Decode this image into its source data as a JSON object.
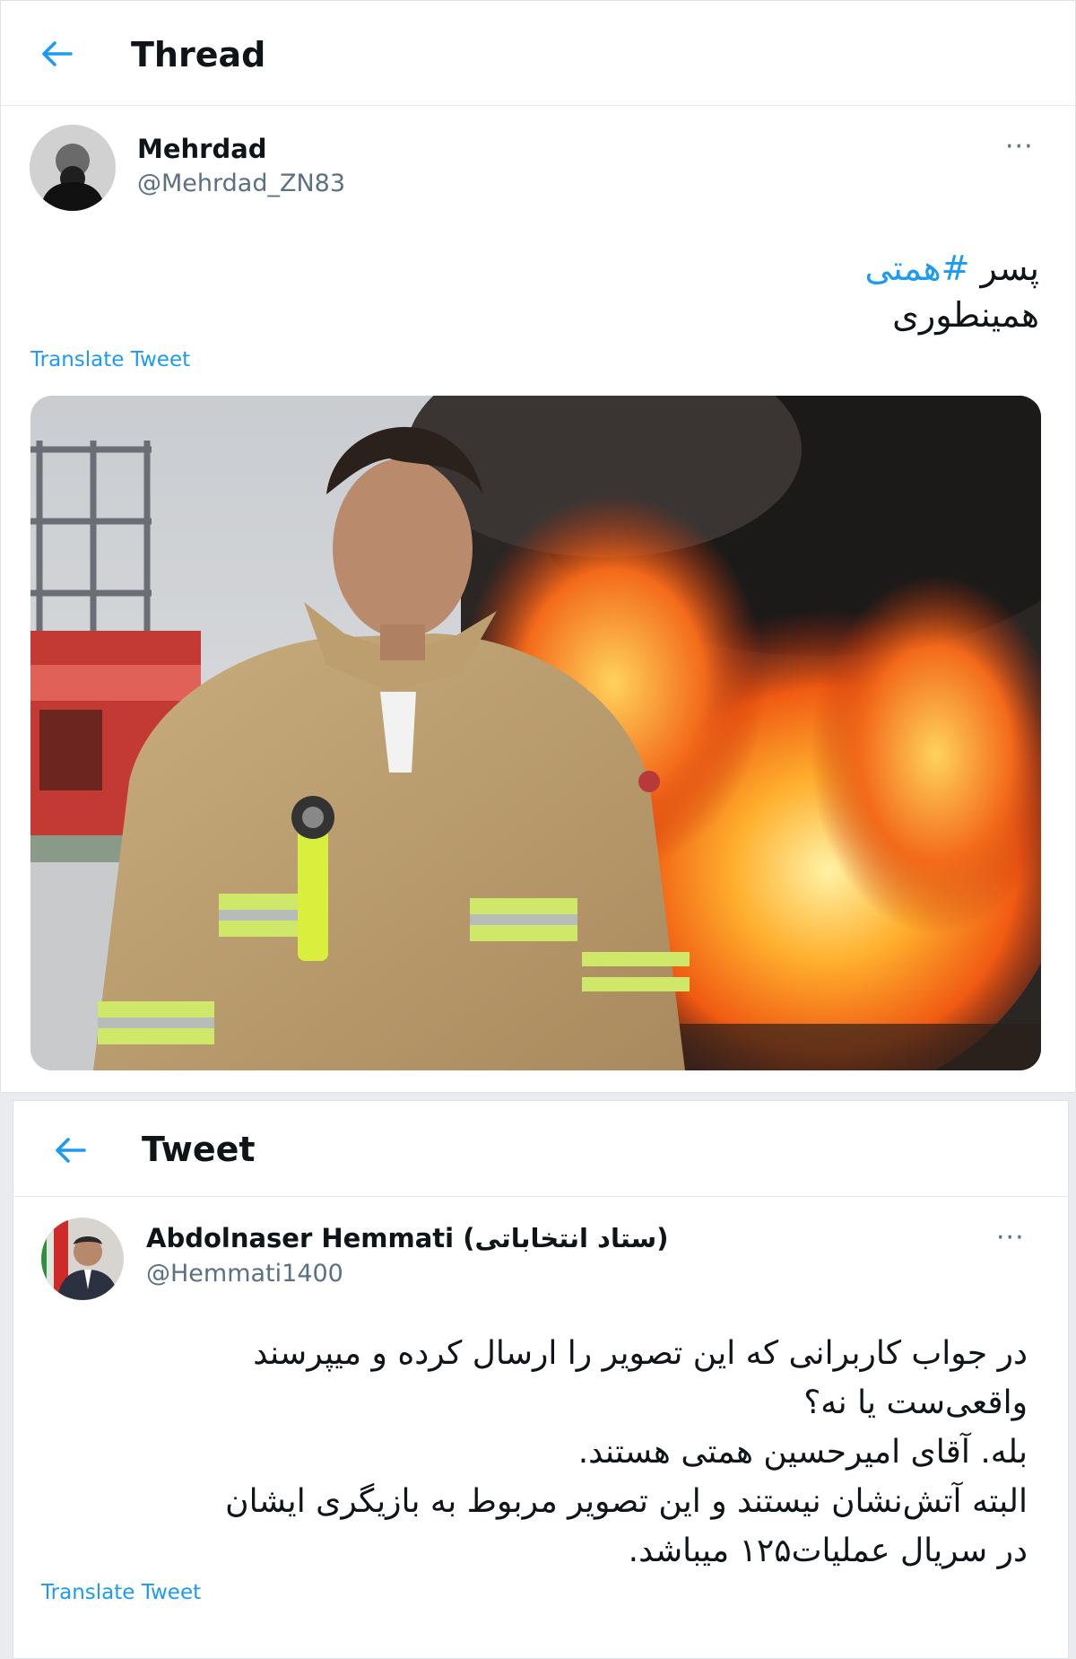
{
  "thread": {
    "header_title": "Thread",
    "author": {
      "display_name": "Mehrdad",
      "handle": "@Mehrdad_ZN83"
    },
    "text": {
      "prefix": "پسر ",
      "hashtag": "#همتی",
      "line2": "همینطوری"
    },
    "translate_label": "Translate Tweet",
    "more_label": "···"
  },
  "reply": {
    "header_title": "Tweet",
    "author": {
      "display_name": "Abdolnaser Hemmati",
      "affiliation": "(ستاد انتخاباتی)",
      "handle": "@Hemmati1400"
    },
    "text_lines": [
      "در جواب کاربرانی که این تصویر را ارسال کرده و میپرسند",
      "واقعی‌ست یا نه؟",
      "بله. آقای امیرحسین همتی هستند.",
      "البته آتش‌نشان نیستند و این تصویر مربوط به بازیگری ایشان",
      "در سریال عملیات۱۲۵ میباشد."
    ],
    "translate_label": "Translate Tweet",
    "more_label": "···"
  },
  "colors": {
    "accent": "#1d9bf0",
    "secondary_text": "#5b7083",
    "border": "#e7ecf0"
  },
  "icons": {
    "back": "arrow-left-icon",
    "more": "more-horizontal-icon"
  }
}
